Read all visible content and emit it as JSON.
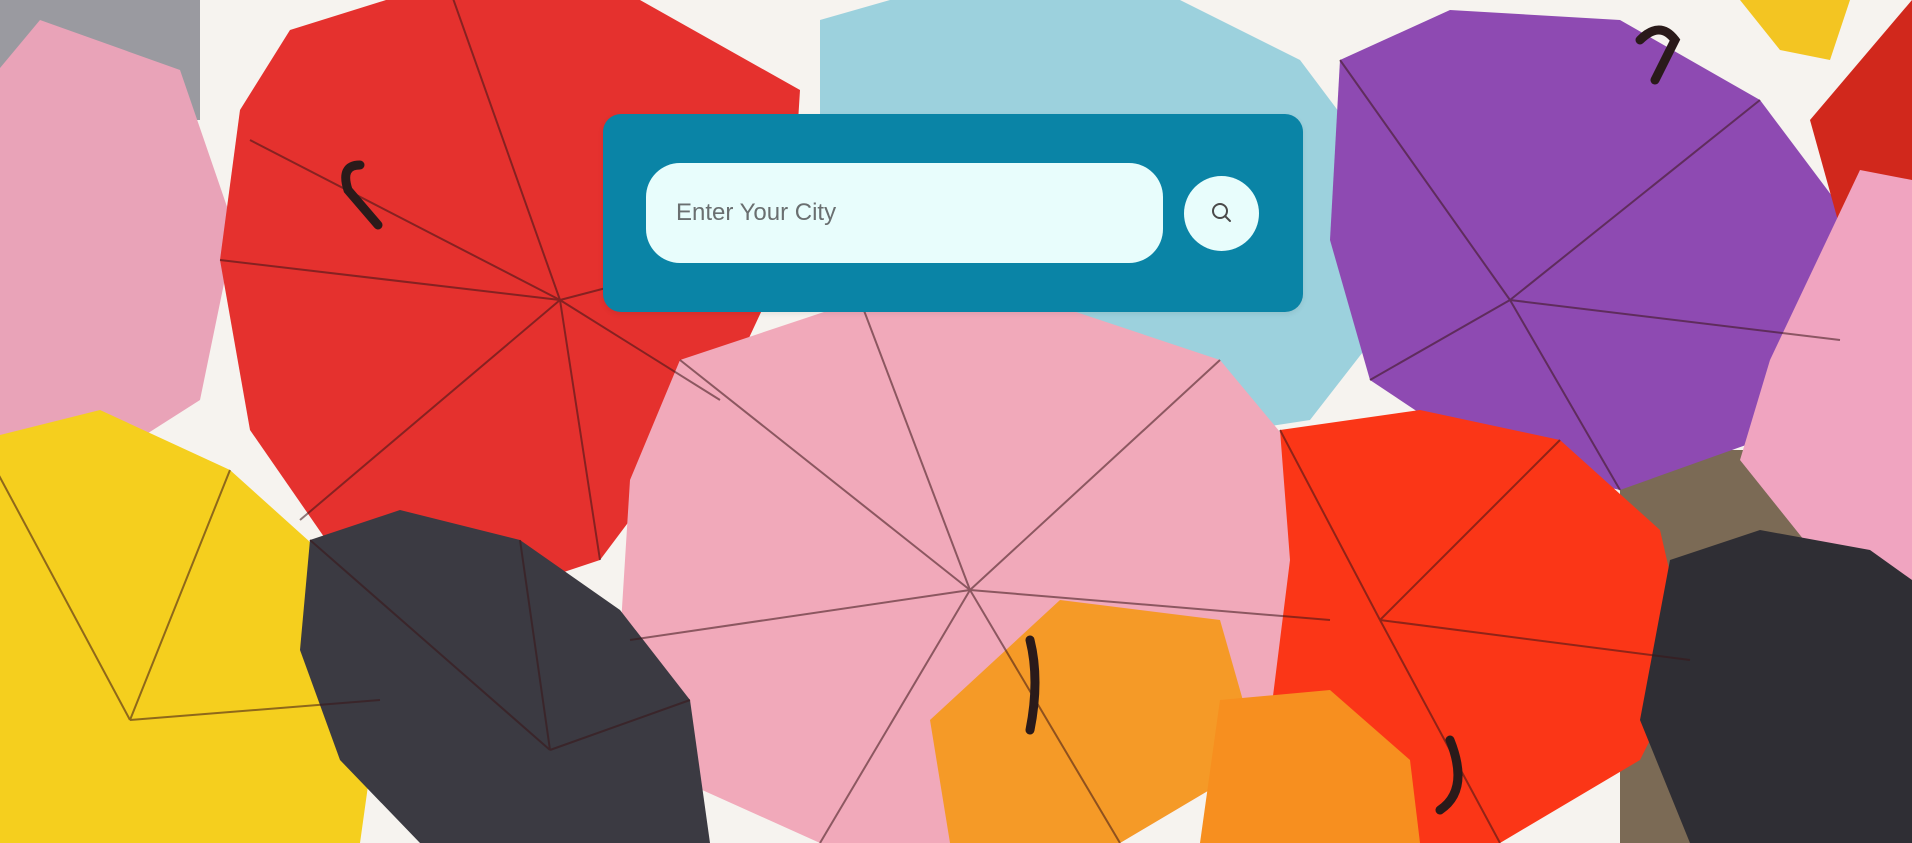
{
  "search": {
    "placeholder": "Enter Your City",
    "value": "",
    "button_icon": "search-icon"
  },
  "colors": {
    "card": "#0a84a6",
    "input_bg": "#e8fdfc",
    "button_bg": "#e8fdfc",
    "icon": "#4a4a4a"
  },
  "background": {
    "image": "colorful-umbrellas"
  }
}
